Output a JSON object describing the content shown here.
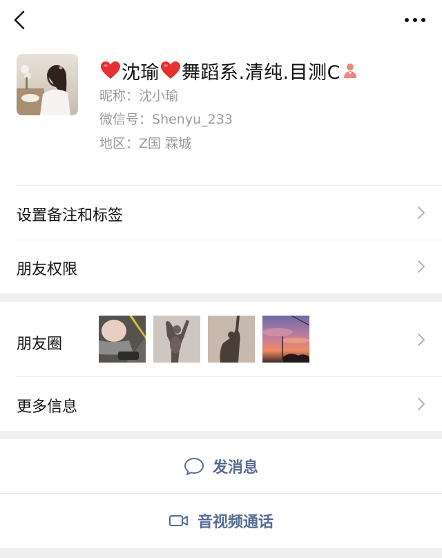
{
  "header": {
    "back_icon": "chevron-left-icon",
    "more_icon": "more-horizontal-icon"
  },
  "profile": {
    "name": "沈瑜",
    "name_suffix": "舞蹈系.清纯.目测C",
    "name_prefix_icon": "red-heart-emoji",
    "name_middle_icon": "red-heart-emoji",
    "name_end_icon": "female-person-icon",
    "nickname_label": "昵称：",
    "nickname": "沈小瑜",
    "wechat_id_label": "微信号：",
    "wechat_id": "Shenyu_233",
    "region_label": "地区：",
    "region": "Z国 霖城"
  },
  "menu": {
    "remark_tags": "设置备注和标签",
    "friend_permissions": "朋友权限",
    "moments": "朋友圈",
    "more_info": "更多信息"
  },
  "actions": {
    "send_message": "发消息",
    "send_message_icon": "chat-bubble-icon",
    "av_call": "音视频通话",
    "av_call_icon": "video-camera-icon"
  },
  "colors": {
    "link_blue": "#576b95",
    "secondary_text": "#9a9a9a",
    "separator_bg": "#efefef",
    "heart_red": "#e5312f"
  }
}
